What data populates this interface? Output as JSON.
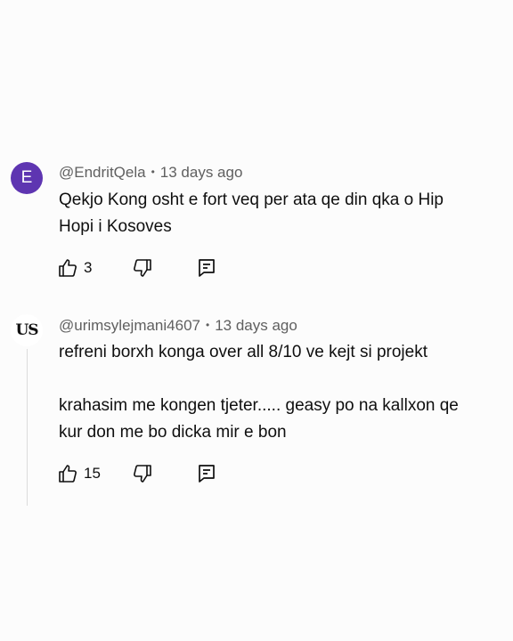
{
  "comments": [
    {
      "avatar_text": "E",
      "avatar_color": "#5e35b1",
      "username": "@EndritQela",
      "time": "13 days ago",
      "lines": [
        "Qekjo Kong osht e fort veq per ata qe din qka o Hip",
        "Hopi i Kosoves"
      ],
      "likes": "3",
      "icons": [
        "thumb-up-icon",
        "thumb-down-icon",
        "reply-icon"
      ]
    },
    {
      "avatar_text": "US",
      "username": "@urimsylejmani4607",
      "time": "13 days ago",
      "lines": [
        "refreni borxh konga over all 8/10 ve kejt si projekt",
        "",
        "krahasim me kongen tjeter..... geasy po na kallxon qe",
        "kur don me bo dicka mir e bon"
      ],
      "likes": "15",
      "icons": [
        "thumb-up-icon",
        "thumb-down-icon",
        "reply-icon"
      ]
    }
  ],
  "separator": "•"
}
